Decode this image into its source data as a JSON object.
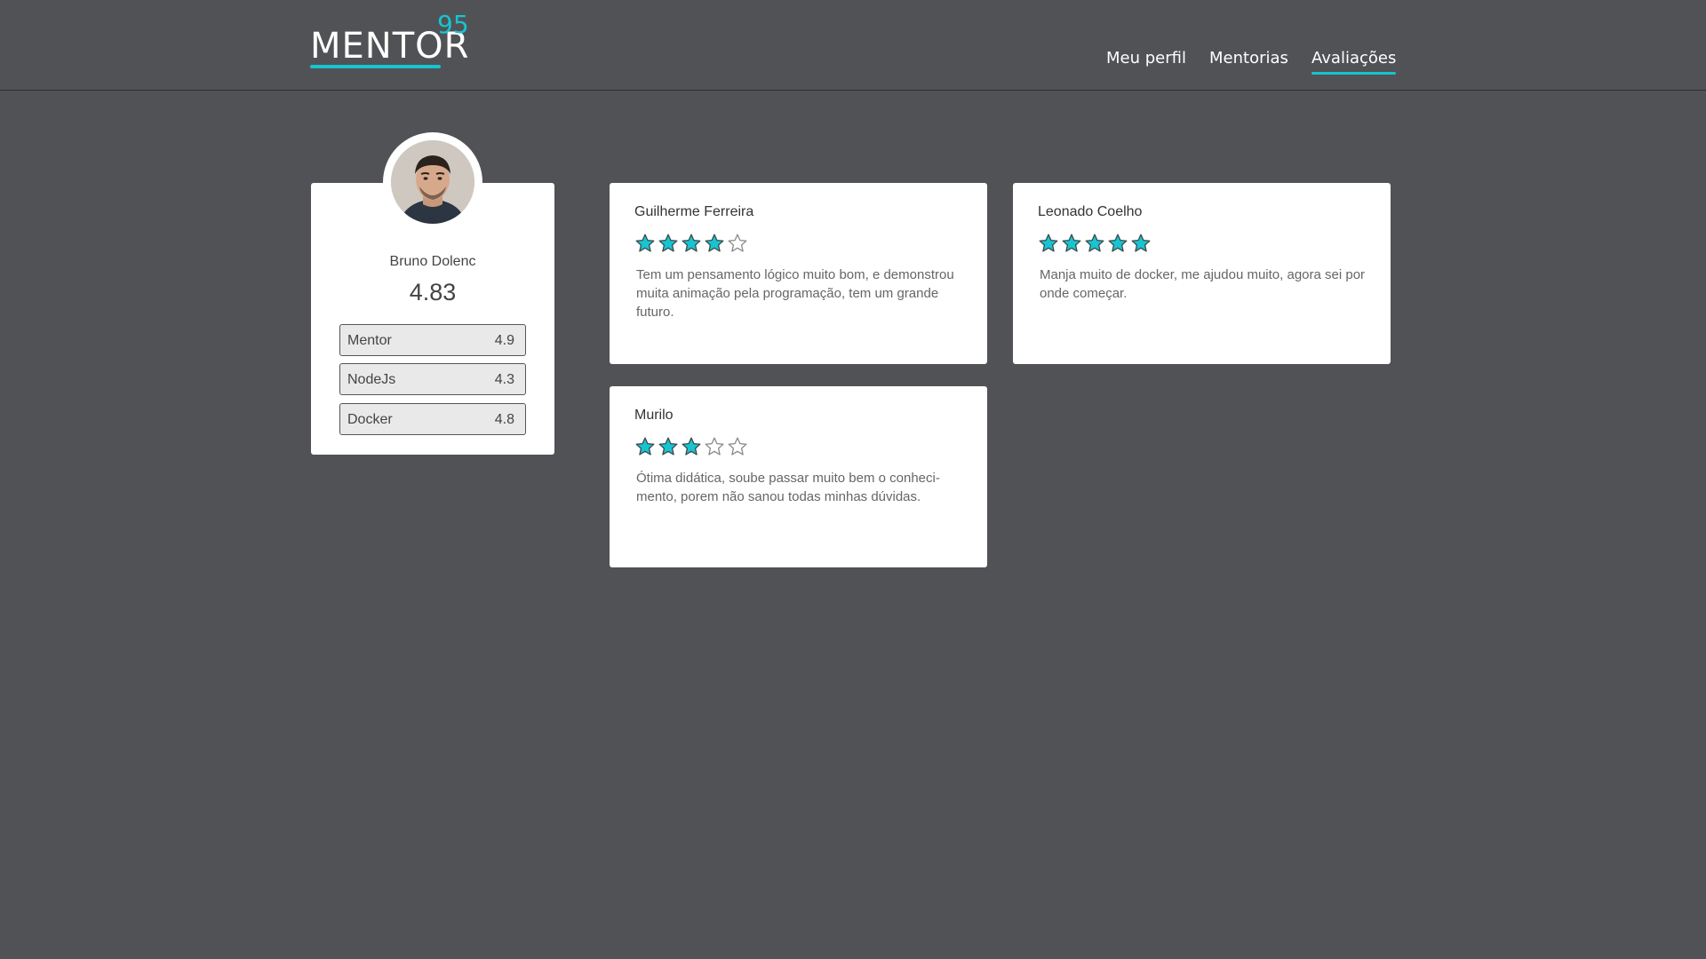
{
  "brand": {
    "name": "MENTOR",
    "superscript": "95",
    "accent": "#17c4d0"
  },
  "nav": {
    "items": [
      {
        "label": "Meu perfil",
        "active": false
      },
      {
        "label": "Mentorias",
        "active": false
      },
      {
        "label": "Avaliações",
        "active": true
      }
    ]
  },
  "profile": {
    "name": "Bruno Dolenc",
    "score": "4.83",
    "skills": [
      {
        "name": "Mentor",
        "value": "4.9"
      },
      {
        "name": "NodeJs",
        "value": "4.3"
      },
      {
        "name": "Docker",
        "value": "4.8"
      }
    ]
  },
  "reviews": [
    {
      "reviewer": "Guilherme Ferreira",
      "rating": 4,
      "text": "Tem um pensamento lógico muito bom, e demonstrou muita animação pela programação, tem um grande futuro."
    },
    {
      "reviewer": "Leonado Coelho",
      "rating": 5,
      "text": "Manja muito de docker, me ajudou muito, agora sei por onde começar."
    },
    {
      "reviewer": "Murilo",
      "rating": 3,
      "text": "Ótima didática, soube passar muito bem o conheci-mento, porem não sanou todas minhas dúvidas."
    }
  ],
  "colors": {
    "background": "#515255",
    "card": "#ffffff",
    "star_filled": "#17c4d0",
    "star_empty": "#ffffff"
  }
}
